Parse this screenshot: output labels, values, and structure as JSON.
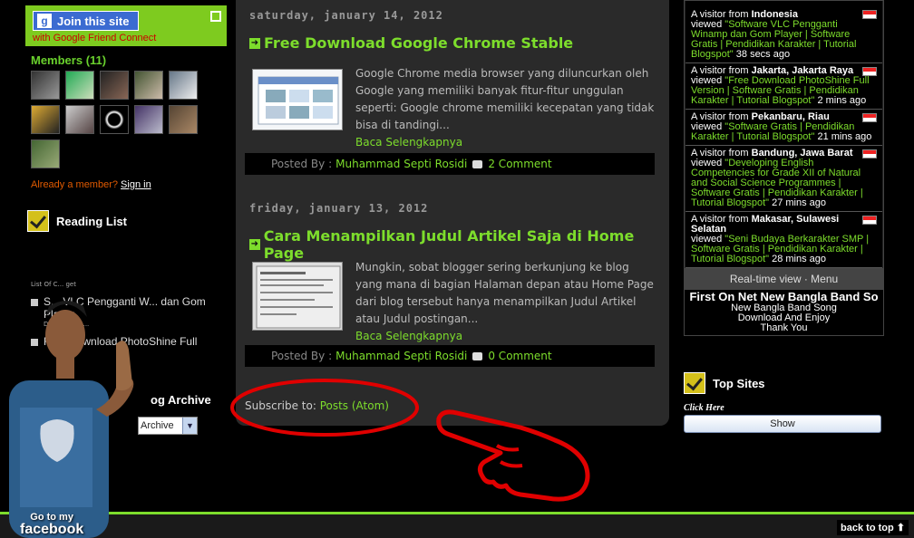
{
  "gfc": {
    "join_label": "Join this site",
    "subtitle": "with Google Friend Connect",
    "members_title": "Members (11)",
    "signin_prefix": "Already a member? ",
    "signin_link": "Sign in"
  },
  "reading_list": {
    "title": "Reading List",
    "small_caption": "List Of C... get",
    "items": [
      {
        "text": "S... VLC Pengganti W... dan Gom Player",
        "date": "Dat... 16, 20..."
      },
      {
        "text": "Free Download PhotoShine Full"
      }
    ]
  },
  "archive": {
    "title": "og Archive",
    "select_value": "Archive"
  },
  "facebook_badge": {
    "line1": "Go to my",
    "line2": "facebook"
  },
  "posts": [
    {
      "date": "saturday, january 14, 2012",
      "title": "Free Download Google Chrome Stable",
      "excerpt": "Google Chrome media browser yang diluncurkan oleh Google yang memiliki banyak fitur-fitur unggulan seperti: Google chrome memiliki kecepatan yang tidak bisa di tandingi...",
      "read_more": "Baca Selengkapnya",
      "posted_by_label": "Posted By :",
      "author": "Muhammad Septi Rosidi",
      "comments": "2 Comment"
    },
    {
      "date": "friday, january 13, 2012",
      "title": "Cara Menampilkan Judul Artikel Saja di Home Page",
      "excerpt": "Mungkin, sobat blogger sering berkunjung ke blog yang mana di bagian Halaman depan atau Home Page dari blog tersebut hanya menampilkan Judul Artikel atau Judul postingan...",
      "read_more": "Baca Selengkapnya",
      "posted_by_label": "Posted By :",
      "author": "Muhammad Septi Rosidi",
      "comments": "0 Comment"
    }
  ],
  "subscribe": {
    "label": "Subscribe to: ",
    "link": "Posts (Atom)"
  },
  "feedjit": {
    "visitors": [
      {
        "prefix": "A visitor from ",
        "place": "Indonesia",
        "viewed": "viewed ",
        "page": "\"Software VLC Pengganti Winamp dan Gom Player | Software Gratis | Pendidikan Karakter | Tutorial Blogspot\"",
        "time": " 38 secs ago"
      },
      {
        "prefix": "A visitor from ",
        "place": "Jakarta, Jakarta Raya",
        "viewed": "viewed ",
        "page": "\"Free Download PhotoShine Full Version | Software Gratis | Pendidikan Karakter | Tutorial Blogspot\"",
        "time": " 2 mins ago"
      },
      {
        "prefix": "A visitor from ",
        "place": "Pekanbaru, Riau",
        "viewed": "viewed ",
        "page": "\"Software Gratis | Pendidikan Karakter | Tutorial Blogspot\"",
        "time": " 21 mins ago"
      },
      {
        "prefix": "A visitor from ",
        "place": "Bandung, Jawa Barat",
        "viewed": "viewed ",
        "page": "\"Developing English Competencies for Grade XII of Natural and Social Science Programmes | Software Gratis | Pendidikan Karakter | Tutorial Blogspot\"",
        "time": " 27 mins ago"
      },
      {
        "prefix": "A visitor from ",
        "place": "Makasar, Sulawesi Selatan",
        "viewed": "viewed ",
        "page": "\"Seni Budaya Berkarakter SMP | Software Gratis | Pendidikan Karakter | Tutorial Blogspot\"",
        "time": " 28 mins ago"
      }
    ],
    "realtime_label": "Real-time view · Menu"
  },
  "band": {
    "title": "First On Net New Bangla Band So",
    "line1": "New Bangla Band Song",
    "line2": "Download And Enjoy",
    "line3": "Thank You"
  },
  "top_sites": {
    "title": "Top Sites",
    "click_here": "Click Here",
    "show_label": "Show"
  },
  "footer": {
    "back_to_top": "back to top"
  },
  "colors": {
    "accent_green": "#7ddd2c",
    "annotation_red": "#e00000",
    "gfc_green": "#7ecb1f"
  }
}
